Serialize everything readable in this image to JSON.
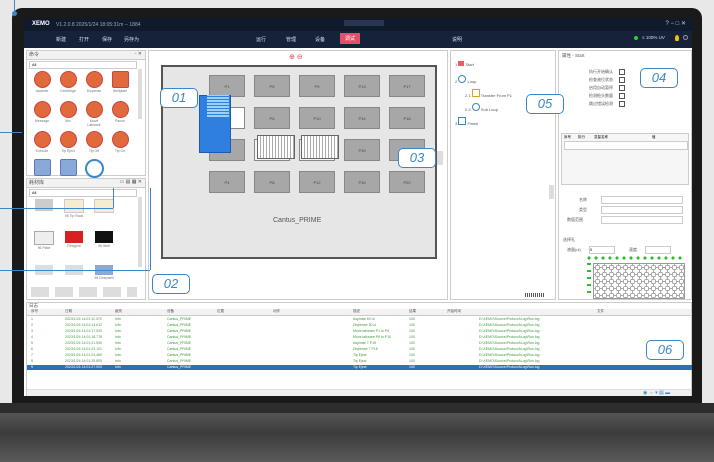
{
  "app": {
    "title": "XEMO",
    "subtitle": "V1.2.0.8  2025/1/24 18:05:31m  --  1884"
  },
  "menu": {
    "items": [
      "新建",
      "打开",
      "保存",
      "另存为"
    ],
    "tabs": [
      "运行",
      "管理",
      "设备",
      "调试",
      "说明"
    ],
    "active_tab": "调试",
    "status_text": "≡ 100%  UV"
  },
  "left_top_panel": {
    "header": "命令",
    "filter": "All",
    "tiles": [
      "Aspirate",
      "Centrifuge",
      "Dispense",
      "Wellplate",
      "Message",
      "Mix",
      "Move Labware",
      "Pause",
      "Execute",
      "Tip Eject",
      "Tip Off",
      "Tip On",
      "",
      "",
      ""
    ]
  },
  "left_bottom_panel": {
    "header": "耗材库",
    "filter": "All",
    "tiles": [
      "",
      "96 Tip Rack",
      "",
      "96 Plate",
      "Reagent",
      "96 Well",
      "",
      "",
      "96 Deepwell",
      "",
      "",
      ""
    ]
  },
  "deck": {
    "label": "Cantus_PRIME",
    "positions": [
      "P1",
      "P5",
      "P9",
      "P13",
      "P17",
      "P2",
      "P6",
      "P10",
      "P14",
      "P18",
      "P3",
      "P7",
      "P11",
      "P15",
      "P19",
      "P4",
      "P8",
      "P12",
      "P16",
      "P20"
    ]
  },
  "protocol": {
    "steps": [
      {
        "num": "1",
        "label": "Start"
      },
      {
        "num": "2",
        "label": "Loop"
      },
      {
        "num": "2.1",
        "label": "Transfer From P1"
      },
      {
        "num": "2.2",
        "label": "Sub Loop"
      },
      {
        "num": "3",
        "label": "Finish"
      }
    ]
  },
  "properties": {
    "header": "属性 - Start",
    "checks": [
      "执行开始确认",
      "检查液位状态",
      "启用自动暂停",
      "检测枪头数量",
      "跳过错误检测"
    ],
    "tabs": [
      "序号",
      "执行",
      "变量名称",
      "值"
    ],
    "fields": [
      "名称",
      "类型",
      "数值范围"
    ],
    "volume_label": "液量(ul)",
    "volume_value": "0",
    "speed_label": "速度",
    "select_label": "选择孔"
  },
  "log": {
    "header": "日志",
    "columns": [
      "序号",
      "日期",
      "级别",
      "设备",
      "位置",
      "动作",
      "描述",
      "结果",
      "开始时间",
      "文件"
    ],
    "rows": [
      [
        "1",
        "2023/1/24 14:01:11.370",
        "Info",
        "Cantus_PRIME",
        "",
        "",
        "Aspirate 50 ul",
        "100",
        "",
        "D:\\XEMO\\Source\\Protocol\\Log\\Run.log"
      ],
      [
        "2",
        "2023/1/24 14:01:13.612",
        "Info",
        "Cantus_PRIME",
        "",
        "",
        "Dispense 50 ul",
        "100",
        "",
        "D:\\XEMO\\Source\\Protocol\\Log\\Run.log"
      ],
      [
        "3",
        "2023/1/24 14:01:17.920",
        "Info",
        "Cantus_PRIME",
        "",
        "",
        "Move labware P1 to P6",
        "100",
        "",
        "D:\\XEMO\\Source\\Protocol\\Log\\Run.log"
      ],
      [
        "4",
        "2023/1/24 14:01:18.778",
        "Info",
        "Cantus_PRIME",
        "",
        "",
        "Move labware P6 to P10",
        "100",
        "",
        "D:\\XEMO\\Source\\Protocol\\Log\\Run.log"
      ],
      [
        "5",
        "2023/1/24 14:01:21.540",
        "Info",
        "Cantus_PRIME",
        "",
        "",
        "Aspirate 7 P15",
        "100",
        "",
        "D:\\XEMO\\Source\\Protocol\\Log\\Run.log"
      ],
      [
        "6",
        "2023/1/24 14:01:23.101",
        "Info",
        "Cantus_PRIME",
        "",
        "",
        "Dispense 7 P15",
        "100",
        "",
        "D:\\XEMO\\Source\\Protocol\\Log\\Run.log"
      ],
      [
        "7",
        "2023/1/24 14:01:24.460",
        "Info",
        "Cantus_PRIME",
        "",
        "",
        "Tip Eject",
        "100",
        "",
        "D:\\XEMO\\Source\\Protocol\\Log\\Run.log"
      ],
      [
        "8",
        "2023/1/24 14:01:25.805",
        "Info",
        "Cantus_PRIME",
        "",
        "",
        "Tip Eject",
        "100",
        "",
        "D:\\XEMO\\Source\\Protocol\\Log\\Run.log"
      ],
      [
        "9",
        "2023/1/24 14:01:27.003",
        "Info",
        "Cantus_PRIME",
        "",
        "",
        "Tip Eject",
        "100",
        "",
        "D:\\XEMO\\Source\\Protocol\\Log\\Run.log"
      ]
    ]
  },
  "callouts": [
    "01",
    "02",
    "03",
    "04",
    "05",
    "06"
  ],
  "colors": {
    "accent": "#3a87c8",
    "active_tab": "#e0506a",
    "log_text": "#3a9a3a",
    "selected_row": "#2f6fb2"
  }
}
